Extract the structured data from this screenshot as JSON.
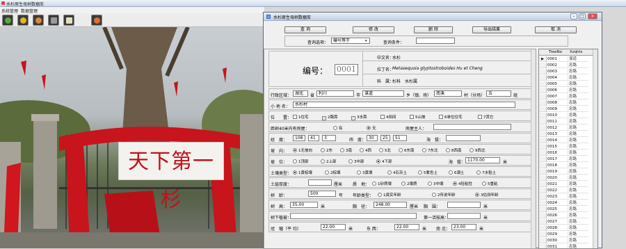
{
  "main_window": {
    "title": "水杉原生母树数据库"
  },
  "menu": {
    "items": [
      "系统管理",
      "数据管理"
    ]
  },
  "toolbar": {
    "buttons": [
      "tree-icon",
      "key-icon",
      "gears-icon",
      "photo-icon",
      "book-icon",
      "globe-icon"
    ]
  },
  "photo": {
    "sign_text": "天下第一杉"
  },
  "dialog": {
    "title": "水杉原生母树数据库",
    "buttons": {
      "query": "查 询",
      "edit": "修 改",
      "delete": "删 除",
      "export": "导出结果",
      "cancel": "取 消"
    },
    "query_option_label": "查询选项：",
    "query_option_value": "编号等于",
    "query_condition_label": "查询条件：",
    "query_condition_value": "",
    "id_label": "编号：",
    "id_value": "0001",
    "cn_name_label": "中文名：",
    "cn_name_value": "水杉",
    "latin_label": "拉丁名：",
    "latin_value": "Metasequoia glyptostroboides Hu et Cheng",
    "family_label": "科　属：",
    "family_value": "杉科　水杉属",
    "region_label": "行政区域：",
    "province": "湖北",
    "province_unit": "省",
    "city": "利川",
    "city_unit": "市",
    "town": "谋道",
    "town_unit": "乡（镇、场）",
    "village": "南溪",
    "village_unit": "村（分场）",
    "group": "五",
    "group_unit": "组",
    "place_label": "小 地 名：",
    "place_value": "水杉村",
    "position_label": "位　　置：",
    "position_options": [
      "1住宅",
      "2路旁",
      "3水旁",
      "4田间",
      "5山坡",
      "6单位住宅",
      "7其它"
    ],
    "position_checked": [
      1,
      2
    ],
    "house_label": "距树40米内有房屋：",
    "house_yes": "有",
    "house_no": "无",
    "owner_label": "房屋主人：",
    "owner_value": "",
    "lon_label": "经　度：",
    "lon_deg": "108",
    "lon_min": "41",
    "lon_sec": "3",
    "lat_label": "纬　度：",
    "lat_deg": "30",
    "lat_min": "25",
    "lat_sec": "51",
    "alt_label": "海　拔：",
    "alt_value": "",
    "slope_dir_label": "坡　向：",
    "slope_dir_options": [
      "1无坡向",
      "2东",
      "3南",
      "4西",
      "5北",
      "6东南",
      "7东北",
      "8西南",
      "9西北"
    ],
    "slope_dir_selected": 0,
    "slope_pos_label": "坡　位：",
    "slope_pos_options": [
      "1顶部",
      "2上部",
      "3中部",
      "4下部"
    ],
    "slope_pos_selected": 3,
    "elevation_label": "海　拔：",
    "elevation_value": "1170.00",
    "elevation_unit": "米",
    "soil_type_label": "土壤类型：",
    "soil_type_options": [
      "1黄棕壤",
      "2棕壤",
      "3黄壤",
      "4石灰土",
      "5紫色土",
      "6潮土",
      "7水稻土"
    ],
    "soil_type_selected": 0,
    "soil_depth_label": "土层厚度：",
    "soil_depth_value": "",
    "soil_depth_unit": "厘米",
    "soil_texture_label": "质　地：",
    "soil_texture_options": [
      "1砂质壤",
      "2壤质",
      "3中壤",
      "4轻粘性",
      "5重粘"
    ],
    "soil_texture_selected": 3,
    "age_label": "树　龄：",
    "age_value": "500",
    "age_unit": "年",
    "age_type_label": "年龄类型：",
    "age_type_options": [
      "1真实年龄",
      "2传说年龄",
      "3估测年龄"
    ],
    "age_type_selected": 2,
    "height_label": "树　高：",
    "height_value": "35.00",
    "height_unit": "米",
    "dbh_label": "胸　径：",
    "dbh_value": "248.00",
    "dbh_unit": "厘米",
    "girth_label": "胸　围：",
    "girth_value": "",
    "girth_unit": "米",
    "under_label": "树下植被：",
    "under_value": "",
    "branch_label": "第一活枝高：",
    "branch_value": "",
    "branch_unit": "米",
    "crown_label": "冠　幅（平 均）",
    "crown_avg": "22.00",
    "crown_ew_label": "东 西：",
    "crown_ew": "22.00",
    "crown_sn_label": "南 北：",
    "crown_sn": "23.00",
    "crown_unit": "米"
  },
  "grid": {
    "columns": [
      "TreeNo",
      "XzqhIx"
    ],
    "rows": [
      [
        "0001",
        "谋道"
      ],
      [
        "0002",
        "忠路"
      ],
      [
        "0003",
        "忠路"
      ],
      [
        "0004",
        "忠路"
      ],
      [
        "0005",
        "忠路"
      ],
      [
        "0006",
        "忠路"
      ],
      [
        "0007",
        "忠路"
      ],
      [
        "0008",
        "忠路"
      ],
      [
        "0009",
        "忠路"
      ],
      [
        "0010",
        "忠路"
      ],
      [
        "0011",
        "忠路"
      ],
      [
        "0012",
        "忠路"
      ],
      [
        "0013",
        "忠路"
      ],
      [
        "0014",
        "忠路"
      ],
      [
        "0015",
        "忠路"
      ],
      [
        "0016",
        "忠路"
      ],
      [
        "0017",
        "忠路"
      ],
      [
        "0018",
        "忠路"
      ],
      [
        "0019",
        "忠路"
      ],
      [
        "0020",
        "忠路"
      ],
      [
        "0021",
        "忠路"
      ],
      [
        "0022",
        "忠路"
      ],
      [
        "0023",
        "忠路"
      ],
      [
        "0024",
        "忠路"
      ],
      [
        "0025",
        "忠路"
      ],
      [
        "0026",
        "忠路"
      ],
      [
        "0027",
        "忠路"
      ],
      [
        "0028",
        "忠路"
      ],
      [
        "0029",
        "忠路"
      ],
      [
        "0030",
        "忠路"
      ],
      [
        "0031",
        "忠路"
      ]
    ]
  }
}
